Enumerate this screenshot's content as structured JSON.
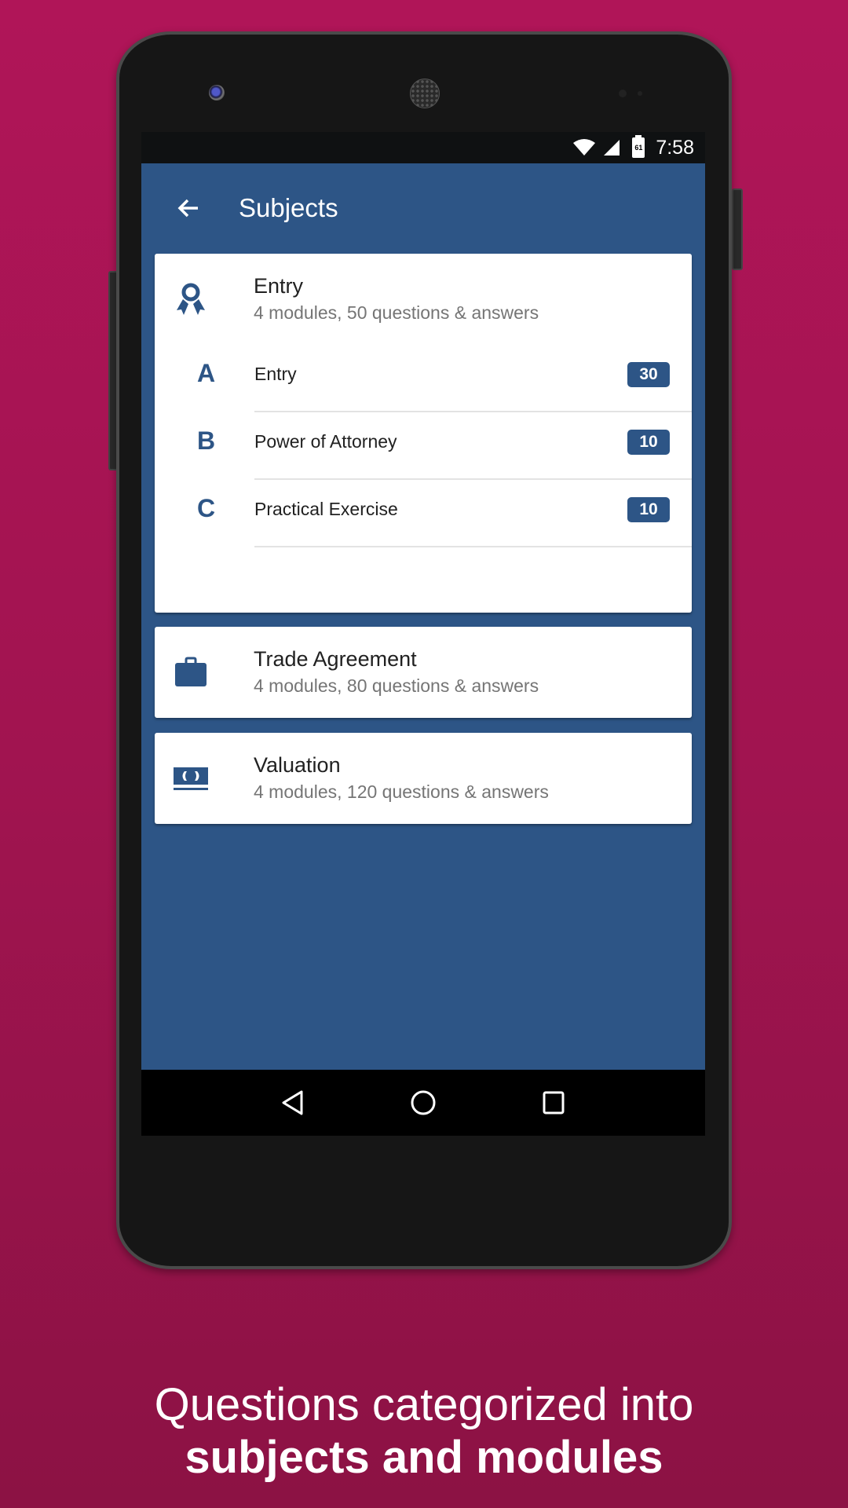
{
  "status_bar": {
    "time": "7:58",
    "battery_level": "61",
    "icons": [
      "wifi-icon",
      "signal-icon",
      "battery-icon"
    ]
  },
  "app_bar": {
    "back_icon": "arrow-back-icon",
    "title": "Subjects"
  },
  "subjects": [
    {
      "icon": "award-ribbon-icon",
      "title": "Entry",
      "subtitle": "4 modules, 50 questions & answers",
      "expanded": true,
      "modules": [
        {
          "letter": "A",
          "title": "Entry",
          "count": "30"
        },
        {
          "letter": "B",
          "title": "Power of Attorney",
          "count": "10"
        },
        {
          "letter": "C",
          "title": "Practical Exercise",
          "count": "10"
        }
      ]
    },
    {
      "icon": "briefcase-icon",
      "title": "Trade Agreement",
      "subtitle": "4 modules, 80 questions & answers",
      "expanded": false
    },
    {
      "icon": "money-icon",
      "title": "Valuation",
      "subtitle": "4 modules, 120 questions & answers",
      "expanded": false
    }
  ],
  "nav_bar": {
    "buttons": [
      "back-triangle-icon",
      "home-circle-icon",
      "recents-square-icon"
    ]
  },
  "caption": {
    "line1": "Questions categorized into",
    "line2": "subjects and modules"
  },
  "colors": {
    "primary": "#2d5586",
    "background": "#a11450",
    "card": "#ffffff"
  }
}
